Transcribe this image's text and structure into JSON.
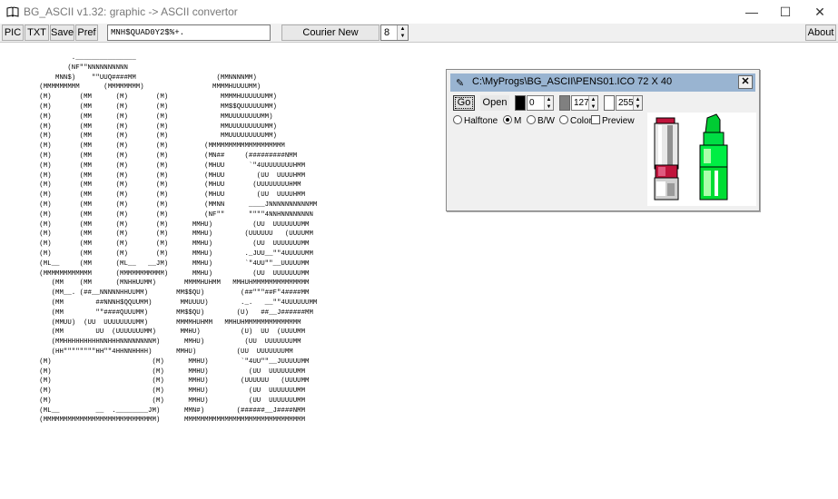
{
  "window": {
    "title": "BG_ASCII v1.32: graphic -> ASCII convertor",
    "minimize_glyph": "—",
    "maximize_glyph": "☐",
    "close_glyph": "✕"
  },
  "toolbar": {
    "pic": "PIC",
    "txt": "TXT",
    "save": "Save",
    "pref": "Pref",
    "charset": "MNH$QUAD0Y2$%+.",
    "font": "Courier New",
    "font_size": "8",
    "about": "About"
  },
  "ascii_art": "           ._______________\n          (NF\"\"NNNNNNNNNN\n       MNN$)    \"\"UUQ####MM                    (MMNNNNMM)\n   (MMMMMMMMM      (MMMMMMMM)                 MMMMHUUUUMM)\n   (M)       (MM      (M)       (M)             MMMMHUUUUUUMM)\n   (M)       (MM      (M)       (M)             MM$$QUUUUUUMM)\n   (M)       (MM      (M)       (M)             MMUUUUUUUUMM)\n   (M)       (MM      (M)       (M)             MMUUUUUUUUUMM)\n   (M)       (MM      (M)       (M)             MMUUUUUUUUUMM)\n   (M)       (MM      (M)       (M)         (MMMMMMMMMMMMMMMMMMM\n   (M)       (MM      (M)       (M)         (MN##     (#########NMM\n   (M)       (MM      (M)       (M)         (MHUU      `\"4UUUUUUUUHMM\n   (M)       (MM      (M)       (M)         (MHUU        (UU  UUUUHMM\n   (M)       (MM      (M)       (M)         (MHUU       (UUUUUUUUHMM\n   (M)       (MM      (M)       (M)         (MHUU        (UU  UUUUHMM\n   (M)       (MM      (M)       (M)         (MMNN      ____JNNNNNNNNNNMM\n   (M)       (MM      (M)       (M)         (NF\"\"      \"\"\"\"4NNHNNNNNNNN\n   (M)       (MM      (M)       (M)      MMHU)          (UU  UUUUUUUMM\n   (M)       (MM      (M)       (M)      MMHU)        (UUUUUU   (UUUUMM\n   (M)       (MM      (M)       (M)      MMHU)          (UU  UUUUUUUMM\n   (M)       (MM      (M)       (M)      MMHU)        ._JUU__\"\"4UUUUUMM\n   (ML__     (MM      (ML__   __JM)      MMHU)        `\"4UU\"\"__UUUUUMM\n   (MMMMMMMMMMMM      (MMMMMMMMMMM)      MMHU)          (UU  UUUUUUUMM\n      (MM    (MM      (MNHHUUMM)       MMMMHUHMM   MMHUHMMMMMMMMMMMMMM\n      (MM__. (##__NNNNNHHUUMM)       MM$$QU)         (##\"\"\"##F\"4####MM\n      (MM        ##NNNH$QQUUMM)       MMUUUU)        ._.   __\"\"4UUUUUUMM\n      (MM        \"\"####QUUUMM)       MM$$QU)        (U)   ##__J######MM\n      (MMUU)  (UU  UUUUUUUUMM)       MMMMHUHMM   MMHUHMMMMMMMMMMMMMM\n      (MM        UU  (UUUUUUUMM)      MMHU)          (U)  UU  (UUUUMM\n      (MMHHHHHHHHHNNHHHNNNNNNNNM)      MMHU)          (UU  UUUUUUUMM\n      (HH\"\"\"\"\"\"\"\"HH\"\"4HHNNHHHH)      MMHU)          (UU  UUUUUUUMM\n   (M)                         (M)      MMHU)        `\"4UU\"\"__JUUUUUMM\n   (M)                         (M)      MMHU)          (UU  UUUUUUUMM\n   (M)                         (M)      MMHU)        (UUUUUU   (UUUUMM\n   (M)                         (M)      MMHU)          (UU  UUUUUUUMM\n   (M)                         (M)      MMHU)          (UU  UUUUUUUMM\n   (ML__         __  .________JM)      MMN#)        (######__J####NMM\n   (MMMMMMMMMMMMMMMMMMMMMMMMMMMM)      MMMMMMMMMMMMMMMMMMMMMMMMMMMMMM",
  "dialog": {
    "title": "C:\\MyProgs\\BG_ASCII\\PENS01.ICO 72 X 40",
    "close_glyph": "✕",
    "go": "Go",
    "open": "Open",
    "black_value": "0",
    "gray_value": "127",
    "white_value": "255",
    "black_color": "#000000",
    "gray_color": "#808080",
    "white_color": "#ffffff",
    "options": {
      "halftone": "Halftone",
      "m": "M",
      "bw": "B/W",
      "color": "Color",
      "preview": "Preview"
    },
    "selected_mode": "M",
    "preview_checked": false
  }
}
